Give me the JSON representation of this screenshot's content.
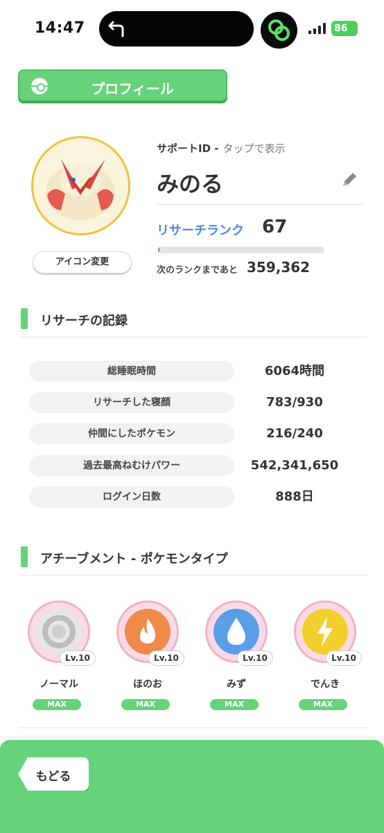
{
  "status_bar": {
    "time": "14:47",
    "battery": "86"
  },
  "header": {
    "title": "プロフィール"
  },
  "profile": {
    "support_id_label": "サポートID -",
    "support_id_hint": "タップで表示",
    "name": "みのる",
    "icon_change_label": "アイコン変更",
    "rank_label": "リサーチランク",
    "rank_value": "67",
    "rank_progress": 0.01,
    "next_rank_label": "次のランクまであと",
    "next_rank_value": "359,362"
  },
  "research_record": {
    "title": "リサーチの記録",
    "stats": [
      {
        "label": "総睡眠時間",
        "value": "6064時間"
      },
      {
        "label": "リサーチした寝顔",
        "value": "783/930"
      },
      {
        "label": "仲間にしたポケモン",
        "value": "216/240"
      },
      {
        "label": "過去最高ねむけパワー",
        "value": "542,341,650"
      },
      {
        "label": "ログイン日数",
        "value": "888日"
      }
    ]
  },
  "achievements": {
    "title": "アチーブメント - ポケモンタイプ",
    "items": [
      {
        "name": "ノーマル",
        "level": "Lv.10",
        "badge": "MAX",
        "icon": "normal-type-icon",
        "color": "#c9c9c9"
      },
      {
        "name": "ほのお",
        "level": "Lv.10",
        "badge": "MAX",
        "icon": "fire-type-icon",
        "color": "#ef8a4b"
      },
      {
        "name": "みず",
        "level": "Lv.10",
        "badge": "MAX",
        "icon": "water-type-icon",
        "color": "#5a9ee8"
      },
      {
        "name": "でんき",
        "level": "Lv.10",
        "badge": "MAX",
        "icon": "electric-type-icon",
        "color": "#f3cf2e"
      }
    ]
  },
  "footer": {
    "back_label": "もどる"
  },
  "colors": {
    "accent_green": "#66d37a",
    "rank_blue": "#4a86e8",
    "avatar_border": "#f0c040"
  }
}
